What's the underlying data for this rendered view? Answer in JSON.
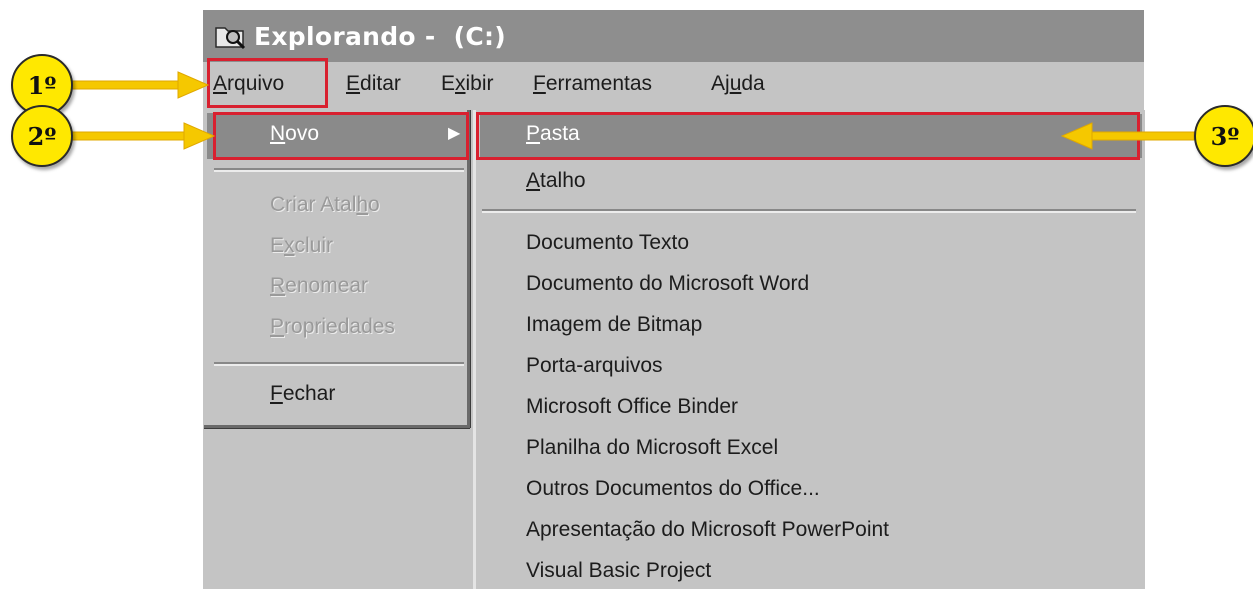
{
  "window": {
    "title": "Explorando -  (C:)",
    "icon": "folder-search-icon"
  },
  "menubar": {
    "arquivo": {
      "hotkey": "A",
      "rest": "rquivo"
    },
    "editar": {
      "hotkey": "E",
      "rest": "ditar"
    },
    "exibir": {
      "pre": "E",
      "hotkey": "x",
      "rest": "ibir"
    },
    "ferramentas": {
      "hotkey": "F",
      "rest": "erramentas"
    },
    "ajuda": {
      "pre": "Aj",
      "hotkey": "u",
      "rest": "da"
    }
  },
  "file_menu": {
    "novo": {
      "hotkey": "N",
      "rest": "ovo"
    },
    "criar_atalho": {
      "pre": "Criar Atal",
      "hotkey": "h",
      "rest": "o"
    },
    "excluir": {
      "pre": "E",
      "hotkey": "x",
      "rest": "cluir"
    },
    "renomear": {
      "hotkey": "R",
      "rest": "enomear"
    },
    "propriedades": {
      "hotkey": "P",
      "rest": "ropriedades"
    },
    "fechar": {
      "hotkey": "F",
      "rest": "echar"
    },
    "submenu_arrow": "▶"
  },
  "new_submenu": {
    "pasta": {
      "hotkey": "P",
      "rest": "asta"
    },
    "atalho": {
      "hotkey": "A",
      "rest": "talho"
    },
    "items": [
      "Documento Texto",
      "Documento do Microsoft Word",
      "Imagem de Bitmap",
      "Porta-arquivos",
      "Microsoft Office Binder",
      "Planilha do Microsoft Excel",
      "Outros Documentos do Office...",
      "Apresentação do Microsoft PowerPoint",
      "Visual Basic Project"
    ]
  },
  "annotations": {
    "step1": "1º",
    "step2": "2º",
    "step3": "3º",
    "highlight_color": "#d8202f",
    "badge_color": "#ffe800",
    "arrow_color": "#f5c800"
  }
}
